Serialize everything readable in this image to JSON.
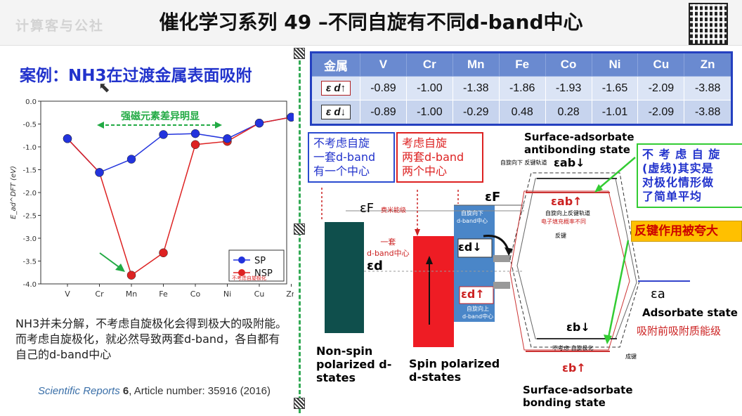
{
  "header": {
    "watermark": "计算客与公社",
    "title": "催化学习系列  49 –不同自旋有不同d-band中心"
  },
  "left": {
    "case_title": "案例：NH3在过渡金属表面吸附",
    "description": "NH3并未分解，不考虑自旋极化会得到极大的吸附能。而考虑自旋极化，就必然导致两套d-band，各自都有自己的d-band中心",
    "reference": {
      "journal": "Scientific Reports",
      "volume": "6",
      "rest": ", Article number: 35916 (2016)"
    }
  },
  "chart_data": {
    "type": "line",
    "categories": [
      "V",
      "Cr",
      "Mn",
      "Fe",
      "Co",
      "Ni",
      "Cu",
      "Zn"
    ],
    "ylabel": "E_ad^DFT (eV)",
    "ylim": [
      -4.0,
      0.0
    ],
    "yticks": [
      "0.0",
      "-0.5",
      "-1.0",
      "-1.5",
      "-2.0",
      "-2.5",
      "-3.0",
      "-3.5",
      "-4.0"
    ],
    "annotation": "强磁元素差异明显",
    "legend_note": "不考虑自旋极化",
    "series": [
      {
        "name": "SP",
        "color": "#2233dd",
        "values": [
          -0.82,
          -1.56,
          -1.27,
          -0.73,
          -0.71,
          -0.82,
          -0.48,
          -0.35
        ]
      },
      {
        "name": "NSP",
        "color": "#dd2222",
        "values": [
          -0.82,
          -1.56,
          -3.81,
          -3.32,
          -0.95,
          -0.88,
          -0.48,
          -0.35
        ]
      }
    ]
  },
  "table": {
    "headers": [
      "金属",
      "V",
      "Cr",
      "Mn",
      "Fe",
      "Co",
      "Ni",
      "Cu",
      "Zn"
    ],
    "rows": [
      {
        "label": "ε d↑",
        "values": [
          "-0.89",
          "-1.00",
          "-1.38",
          "-1.86",
          "-1.93",
          "-1.65",
          "-2.09",
          "-3.88"
        ]
      },
      {
        "label": "ε d↓",
        "values": [
          "-0.89",
          "-1.00",
          "-0.29",
          "0.48",
          "0.28",
          "-1.01",
          "-2.09",
          "-3.88"
        ]
      }
    ]
  },
  "diagram": {
    "box_nonspin": "不考虑自旋\n一套d-band\n有一个中心",
    "box_spin": "考虑自旋\n两套d-band\n两个中心",
    "box_avg": "不 考 虑 自 旋\n(虚线)其实是\n对极化情形做\n了简单平均",
    "box_antibond": "反键作用被夸大",
    "ef_label": "εF",
    "ef_label2": "εF",
    "fermi_note": "费米能级",
    "one_set": "一套\nd-band中心",
    "ed_label": "εd",
    "ed_down": "εd↓",
    "ed_up": "εd↑",
    "spin_down_center": "自旋向下\nd-band中心",
    "spin_up_center": "自旋向上\nd-band中心",
    "nonspin_caption": "Non-spin\npolarized d-\nstates",
    "spin_caption": "Spin polarized\nd-states",
    "antibond_title": "Surface-adsorbate\nantibonding state",
    "bond_title": "Surface-adsorbate\nbonding state",
    "eab_down": "εab↓",
    "eab_up": "εab↑",
    "eb_down": "εb↓",
    "eb_up": "εb↑",
    "ea_label": "εa",
    "adsorbate_state": "Adsorbate state",
    "adsorbate_cn": "吸附前吸附质能级",
    "note_down_anti": "自旋向下 反键轨道",
    "note_up_anti": "自旋向上反键轨道",
    "note_fill": "电子填充概率不同",
    "note_anti": "反键",
    "note_nonpol": "不考虑  自旋极化",
    "note_bond": "成键"
  }
}
